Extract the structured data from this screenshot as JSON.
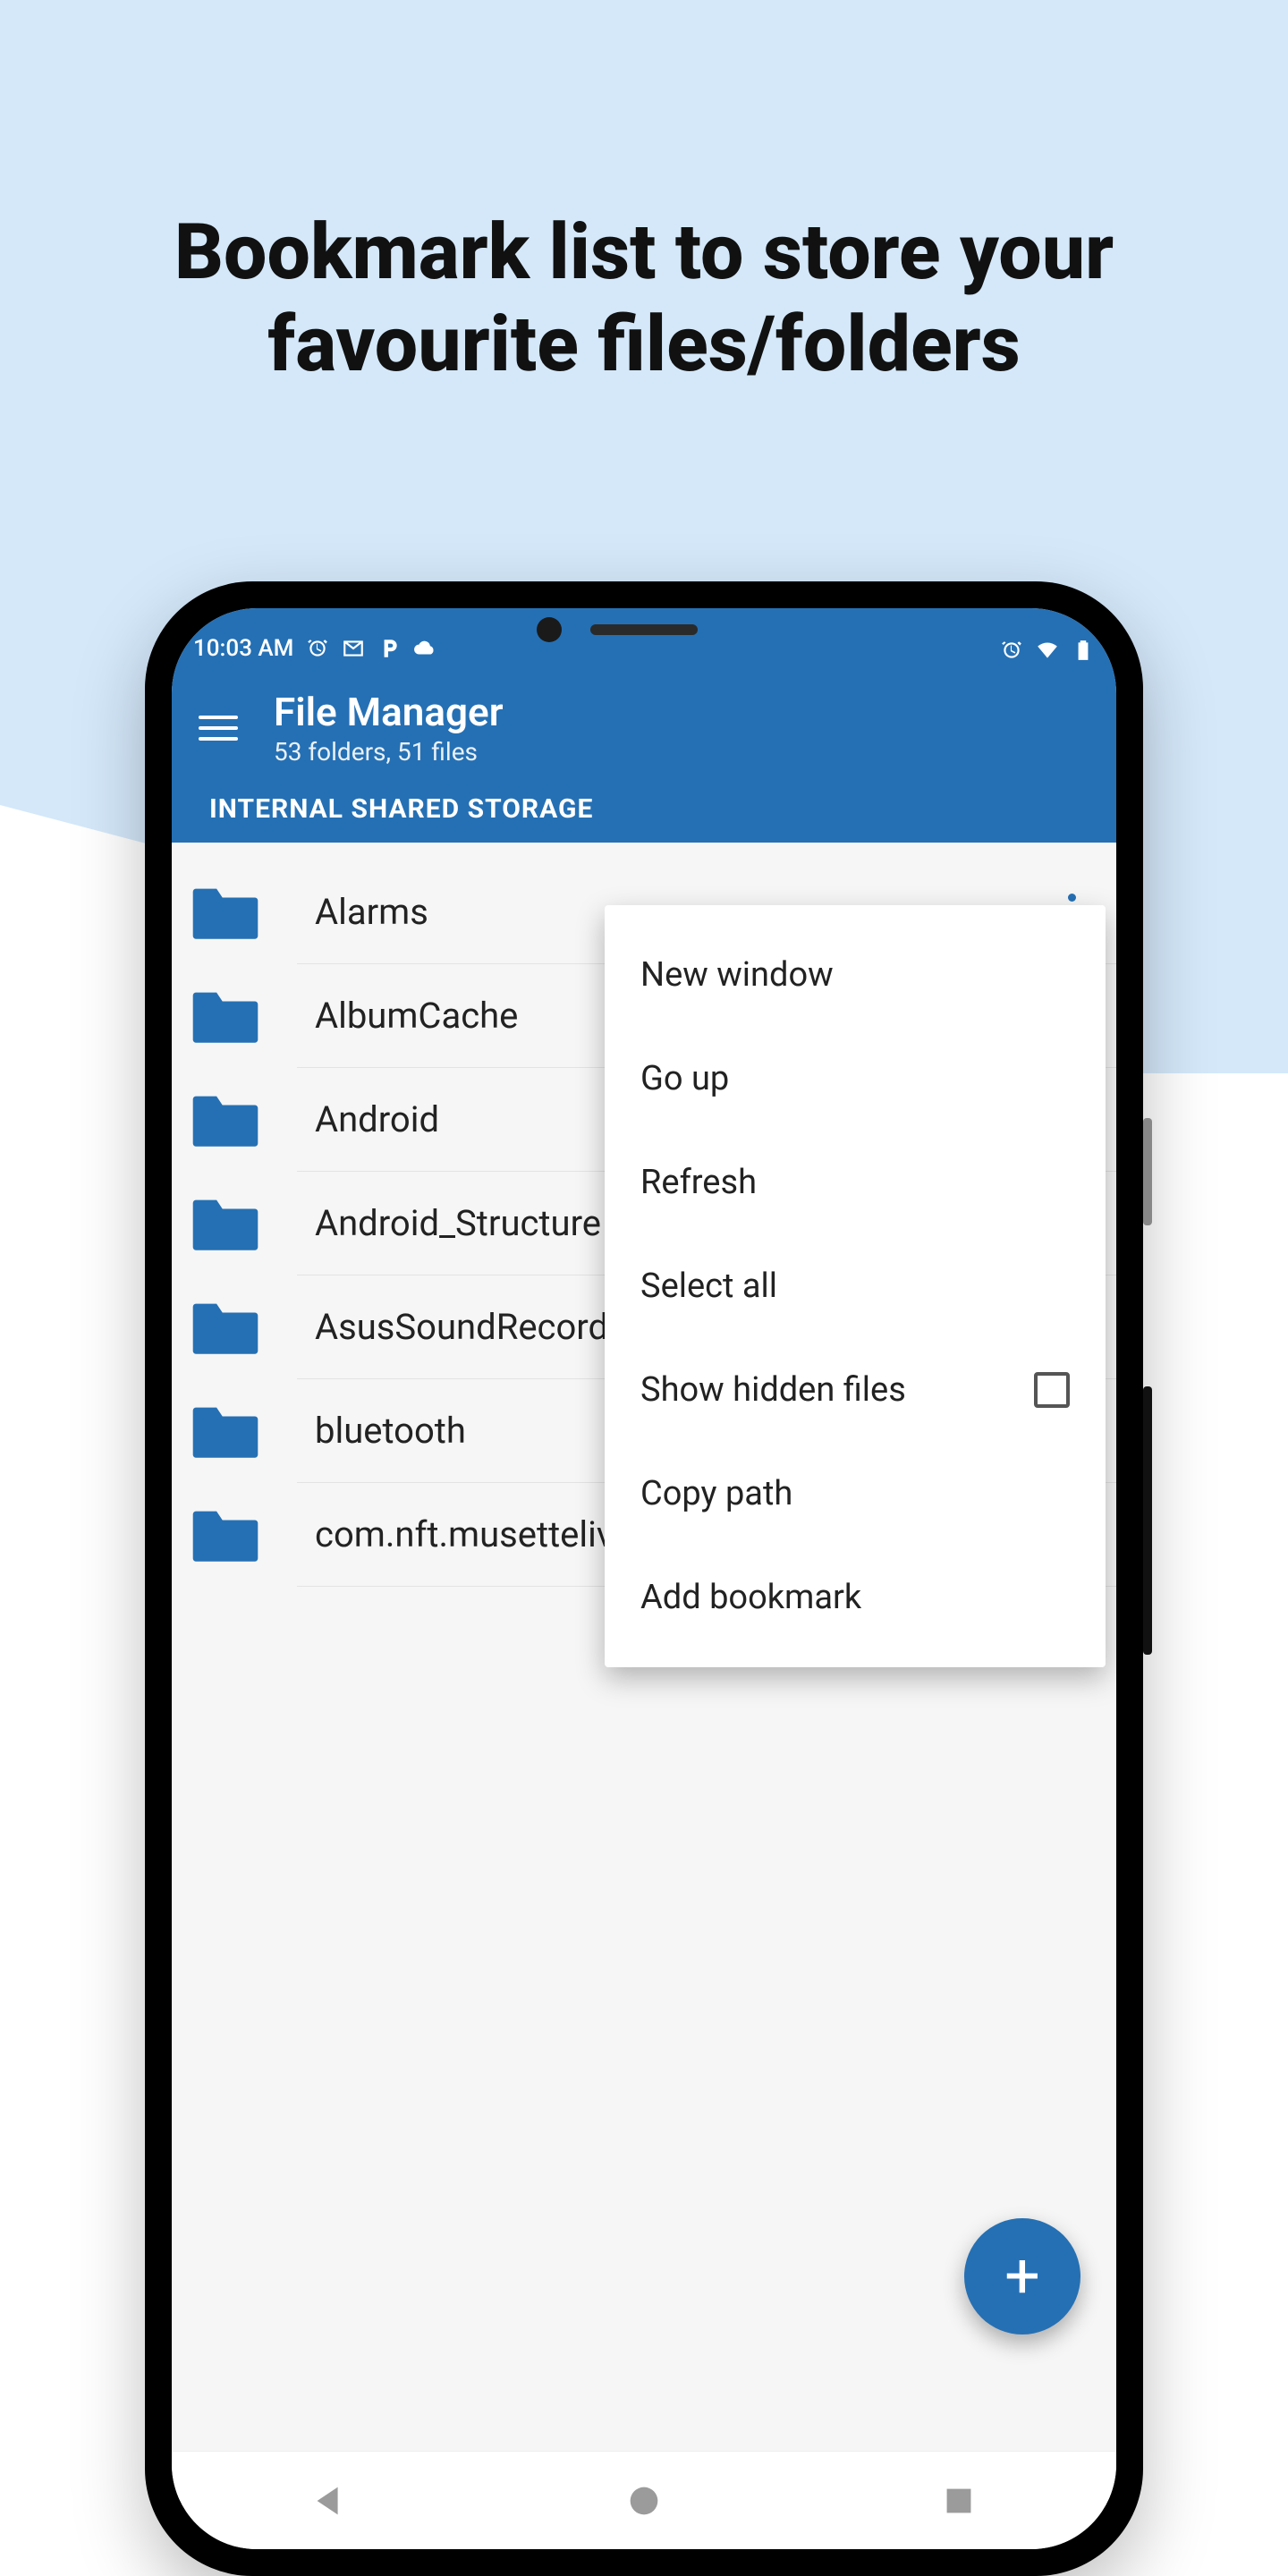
{
  "headline": "Bookmark list to store your favourite files/folders",
  "status": {
    "time": "10:03 AM"
  },
  "app": {
    "title": "File Manager",
    "subtitle": "53 folders, 51 files",
    "tab": "INTERNAL SHARED STORAGE"
  },
  "folders": [
    {
      "name": "Alarms"
    },
    {
      "name": "AlbumCache"
    },
    {
      "name": "Android"
    },
    {
      "name": "Android_Structure"
    },
    {
      "name": "AsusSoundRecorder"
    },
    {
      "name": "bluetooth"
    },
    {
      "name": "com.nft.musettelive"
    }
  ],
  "menu": {
    "new_window": "New window",
    "go_up": "Go up",
    "refresh": "Refresh",
    "select_all": "Select all",
    "show_hidden": "Show hidden files",
    "copy_path": "Copy path",
    "add_bookmark": "Add bookmark"
  },
  "fab_label": "+",
  "colors": {
    "primary": "#2570b4",
    "bg_light": "#d4e8fa"
  }
}
